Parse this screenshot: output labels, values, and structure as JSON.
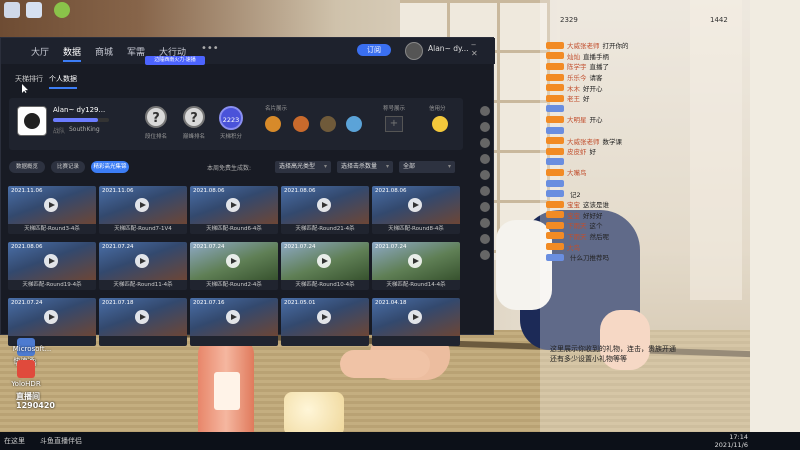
{
  "window": {
    "nav": {
      "tabs": [
        "大厅",
        "数据",
        "商城",
        "军需",
        "大行动"
      ],
      "active_tab": "数据",
      "more": "•••",
      "button": "订阅",
      "user_name": "Alan~ dy...",
      "user_sub": "",
      "banner": "边陲西南火力·速播"
    },
    "sub_tabs": [
      "天梯排行",
      "个人数据"
    ],
    "profile": {
      "name": "Alan~ dy129...",
      "level_progress": 0.8,
      "guild_label": "战队",
      "guild": "SouthKing",
      "rank_slots": [
        {
          "symbol": "?",
          "label": "段位排名"
        },
        {
          "symbol": "?",
          "label": "巅峰排名"
        }
      ],
      "score": "2223",
      "score_label": "天梯积分",
      "section_medals": "名片展示",
      "section_title": "称号展示",
      "section_credit": "信用分",
      "add": "+"
    },
    "filters": {
      "buttons": [
        "数据概览",
        "比赛记录",
        "精彩高光集锦"
      ],
      "active_index": 2,
      "label": "本周免费生成数:",
      "dropdowns": [
        "选择高光类型",
        "选择击杀数量",
        "全部"
      ]
    },
    "videos": [
      {
        "date": "2021.11.06",
        "title": "天梯匹配-Round3-4杀",
        "theme": "blue"
      },
      {
        "date": "2021.11.06",
        "title": "天梯匹配-Round7-1V4",
        "theme": "blue"
      },
      {
        "date": "2021.08.06",
        "title": "天梯匹配-Round6-4杀",
        "theme": "blue"
      },
      {
        "date": "2021.08.06",
        "title": "天梯匹配-Round21-4杀",
        "theme": "blue"
      },
      {
        "date": "2021.08.06",
        "title": "天梯匹配-Round8-4杀",
        "theme": "blue"
      },
      {
        "date": "2021.08.06",
        "title": "天梯匹配-Round19-4杀",
        "theme": "blue"
      },
      {
        "date": "2021.07.24",
        "title": "天梯匹配-Round11-4杀",
        "theme": "blue"
      },
      {
        "date": "2021.07.24",
        "title": "天梯匹配-Round2-4杀",
        "theme": "green"
      },
      {
        "date": "2021.07.24",
        "title": "天梯匹配-Round10-4杀",
        "theme": "green"
      },
      {
        "date": "2021.07.24",
        "title": "天梯匹配-Round14-4杀",
        "theme": "green"
      },
      {
        "date": "2021.07.24",
        "title": "",
        "theme": "blue"
      },
      {
        "date": "2021.07.18",
        "title": "",
        "theme": "blue"
      },
      {
        "date": "2021.07.16",
        "title": "",
        "theme": "blue"
      },
      {
        "date": "2021.05.01",
        "title": "",
        "theme": "blue"
      },
      {
        "date": "2021.04.18",
        "title": "",
        "theme": "blue"
      }
    ]
  },
  "desktop": {
    "icons": [
      {
        "label": "浏览器"
      },
      {
        "label": "快速通"
      },
      {
        "label": "Microsoft..."
      },
      {
        "label": "YoloHDR"
      }
    ],
    "watermark_line1": "直播间",
    "watermark_line2": "1290420"
  },
  "stream": {
    "top_left": "2329",
    "top_right": "1442",
    "chat": [
      {
        "name": "大威张老师",
        "msg": "打开你的",
        "lvl": "orange"
      },
      {
        "name": "灿灿",
        "msg": "直播手柄",
        "lvl": "orange"
      },
      {
        "name": "陈学宇",
        "msg": "直播了",
        "lvl": "orange"
      },
      {
        "name": "乐乐今",
        "msg": "请客",
        "lvl": "orange"
      },
      {
        "name": "木木",
        "msg": "好开心",
        "lvl": "orange"
      },
      {
        "name": "老王",
        "msg": "好",
        "lvl": "orange"
      },
      {
        "name": "",
        "msg": "",
        "lvl": "blue"
      },
      {
        "name": "大明星",
        "msg": "开心",
        "lvl": "orange"
      },
      {
        "name": "",
        "msg": "",
        "lvl": "blue"
      },
      {
        "name": "大威张老师",
        "msg": "数学课",
        "lvl": "orange"
      },
      {
        "name": "皮皮虾",
        "msg": "好",
        "lvl": "orange"
      },
      {
        "name": "",
        "msg": "",
        "lvl": "blue"
      },
      {
        "name": "大嘴鸟",
        "msg": "",
        "lvl": "orange"
      },
      {
        "name": "",
        "msg": "",
        "lvl": "blue"
      },
      {
        "name": "",
        "msg": "记2",
        "lvl": "blue"
      },
      {
        "name": "宝宝",
        "msg": "这该是谁",
        "lvl": "orange"
      },
      {
        "name": "宝宝",
        "msg": "好好好",
        "lvl": "orange"
      },
      {
        "name": "下雨天",
        "msg": "这个",
        "lvl": "orange"
      },
      {
        "name": "下雨天",
        "msg": "然后呢",
        "lvl": "orange"
      },
      {
        "name": "大鸟",
        "msg": "",
        "lvl": "orange"
      },
      {
        "name": "",
        "msg": "什么刀推荐吗",
        "lvl": "blue"
      }
    ],
    "gift_msgs": [
      "这里展示你收到的礼物，连击，贵族开通",
      "还有多少设置小礼物等等"
    ]
  },
  "taskbar": {
    "start": "在这里",
    "app": "斗鱼直播伴侣",
    "time": "17:14",
    "date": "2021/11/6"
  },
  "colors": {
    "accent": "#3c7df5",
    "client_bg": "#181b24"
  }
}
